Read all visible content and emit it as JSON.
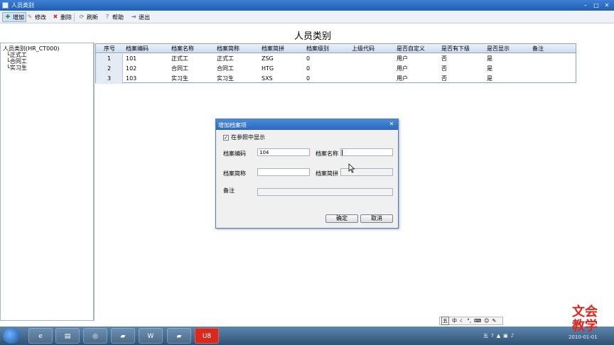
{
  "window": {
    "title": "人员类别"
  },
  "toolbar": {
    "add": "增加",
    "edit": "修改",
    "delete": "删除",
    "refresh": "刷新",
    "help": "帮助",
    "exit": "退出"
  },
  "page_title": "人员类别",
  "tree": {
    "root": "人员类别(HR_CT000)",
    "items": [
      "正式工",
      "合同工",
      "实习生"
    ]
  },
  "grid": {
    "headers": [
      "序号",
      "档案编码",
      "档案名称",
      "档案简称",
      "档案简拼",
      "档案级别",
      "上级代码",
      "是否自定义",
      "是否有下级",
      "是否显示",
      "备注"
    ],
    "rows": [
      [
        "1",
        "101",
        "正式工",
        "正式工",
        "ZSG",
        "0",
        "",
        "用户",
        "否",
        "是",
        ""
      ],
      [
        "2",
        "102",
        "合同工",
        "合同工",
        "HTG",
        "0",
        "",
        "用户",
        "否",
        "是",
        ""
      ],
      [
        "3",
        "103",
        "实习生",
        "实习生",
        "SXS",
        "0",
        "",
        "用户",
        "否",
        "是",
        ""
      ]
    ]
  },
  "dialog": {
    "title": "增加档案项",
    "show_in_ref_label": "在参照中显示",
    "show_in_ref_checked": true,
    "code_label": "档案编码",
    "code_value": "104",
    "name_label": "档案名称",
    "name_value": "",
    "abbr_label": "档案简称",
    "abbr_value": "",
    "pinyin_label": "档案简拼",
    "pinyin_value": "",
    "memo_label": "备注",
    "memo_value": "",
    "ok": "确定",
    "cancel": "取消"
  },
  "ime": {
    "mode": "中"
  },
  "taskbar": {
    "clock": "2010-01-01"
  },
  "watermark": {
    "line1": "文会",
    "line2": "教学"
  },
  "colors": {
    "titlebar": "#2a68bd",
    "grid_header": "#cddcf0",
    "watermark": "#e3241b"
  }
}
